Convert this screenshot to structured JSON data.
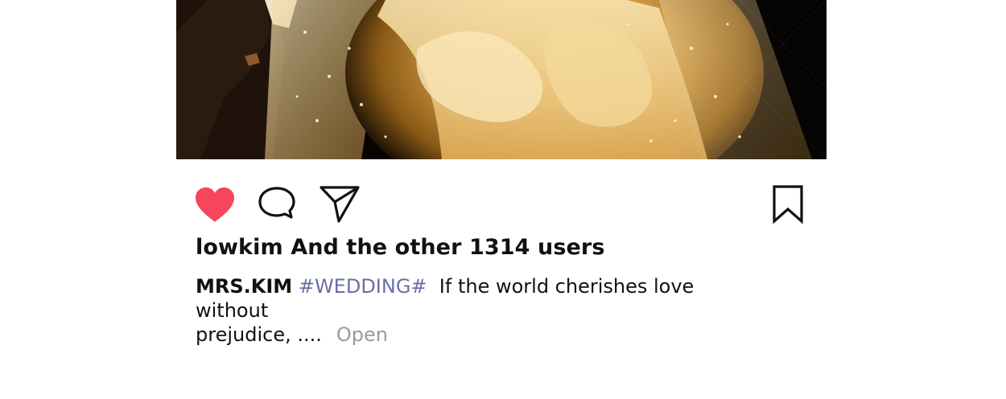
{
  "post": {
    "image_icon": "wedding-photo-veil"
  },
  "actions": {
    "like_icon": "heart-filled-icon",
    "like_color": "#f5465c",
    "comment_icon": "comment-bubble-icon",
    "share_icon": "paper-plane-icon",
    "save_icon": "bookmark-icon"
  },
  "likes": {
    "text": "lowkim And the other 1314 users"
  },
  "caption": {
    "username": "MRS.KIM",
    "hashtag": "#WEDDING#",
    "text_line1": "If the world cherishes love without",
    "text_line2": "prejudice, ....",
    "more_label": "Open",
    "hashtag_color": "#6a6fa6"
  }
}
